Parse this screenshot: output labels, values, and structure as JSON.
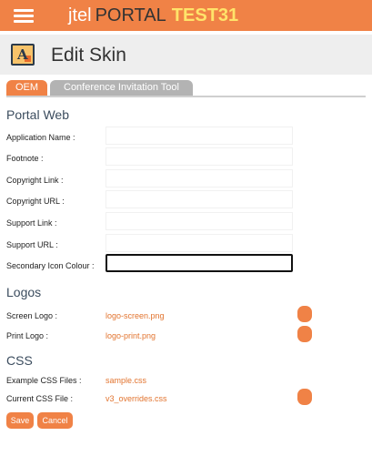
{
  "header": {
    "brand_j": "j",
    "brand_tel": "tel",
    "brand_portal": "PORTAL",
    "brand_env": "TEST31",
    "accent_color": "#f08246",
    "env_color": "#ffe36a"
  },
  "page": {
    "title": "Edit Skin",
    "icon": "skin-icon"
  },
  "tabs": [
    {
      "label": "OEM",
      "active": true
    },
    {
      "label": "Conference Invitation Tool",
      "active": false
    }
  ],
  "sections": {
    "portal_web": "Portal Web",
    "logos": "Logos",
    "css": "CSS"
  },
  "portal_web_fields": [
    {
      "label": "Application Name :",
      "value": ""
    },
    {
      "label": "Footnote :",
      "value": ""
    },
    {
      "label": "Copyright Link :",
      "value": ""
    },
    {
      "label": "Copyright URL :",
      "value": ""
    },
    {
      "label": "Support Link :",
      "value": ""
    },
    {
      "label": "Support URL :",
      "value": ""
    },
    {
      "label": "Secondary Icon Colour :",
      "value": ""
    }
  ],
  "logos": [
    {
      "label": "Screen Logo :",
      "file": "logo-screen.png"
    },
    {
      "label": "Print Logo :",
      "file": "logo-print.png"
    }
  ],
  "css": [
    {
      "label": "Example CSS Files :",
      "file": "sample.css"
    },
    {
      "label": "Current CSS File :",
      "file": "v3_overrides.css"
    }
  ],
  "actions": {
    "save": "Save",
    "cancel": "Cancel"
  }
}
